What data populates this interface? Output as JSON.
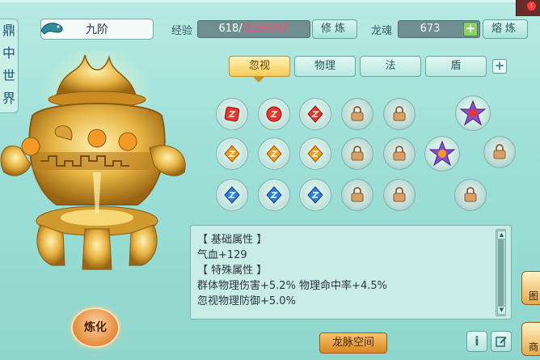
{
  "sidebar": {
    "title_chars": [
      "鼎",
      "中",
      "世",
      "界"
    ]
  },
  "header": {
    "rank_name": "九阶",
    "exp": {
      "label": "经验",
      "current": "618",
      "slash": "/",
      "max": "1290000"
    },
    "train_button": "修炼",
    "soul": {
      "label": "龙魂",
      "value": "673"
    },
    "smelt_button": "熔炼"
  },
  "tabs": [
    {
      "label": "忽视",
      "active": true
    },
    {
      "label": "物理",
      "active": false
    },
    {
      "label": "法",
      "active": false
    },
    {
      "label": "盾",
      "active": false
    }
  ],
  "gems": {
    "row1": [
      "red-gem",
      "red-gem",
      "red-gem",
      "locked",
      "locked",
      "special-purple"
    ],
    "row2": [
      "orange-gem",
      "orange-gem",
      "orange-gem",
      "locked",
      "locked",
      "special-purple",
      "locked"
    ],
    "row3": [
      "blue-gem",
      "blue-gem",
      "blue-gem",
      "locked",
      "locked",
      "locked"
    ]
  },
  "attributes": {
    "base_header": "【 基础属性 】",
    "base_lines": [
      "气血+129"
    ],
    "special_header": "【 特殊属性 】",
    "special_lines": [
      "群体物理伤害+5.2%  物理命中率+4.5%",
      "忽视物理防御+5.0%"
    ]
  },
  "refine_button": "炼化",
  "dragon_space_button": "龙脉空间",
  "info_button": "i",
  "edge": {
    "label_1": "图",
    "label_2": "商"
  },
  "colors": {
    "accent_gold": "#f6cc59",
    "panel_teal": "#9ee0d8",
    "exp_red": "#ff5566"
  }
}
